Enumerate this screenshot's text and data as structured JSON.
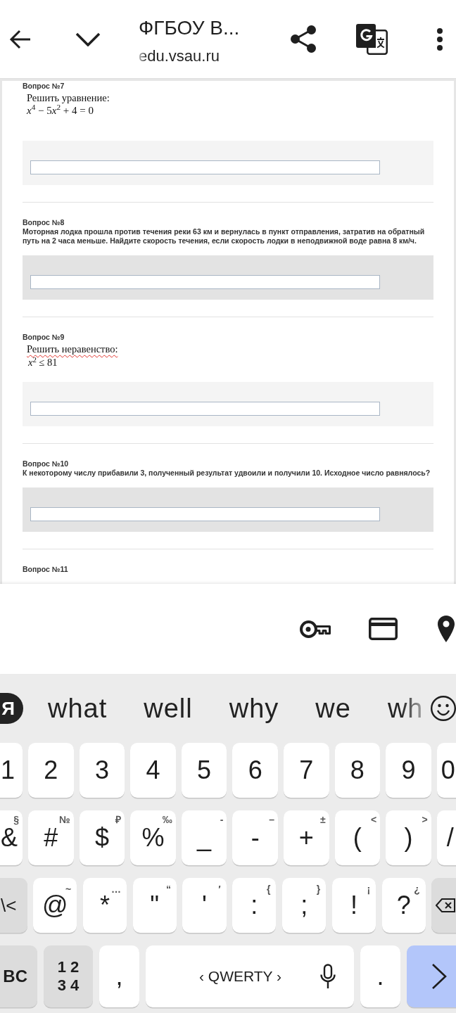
{
  "browser_bar": {
    "title": "ФГБОУ В...",
    "url": "edu.vsau.ru"
  },
  "questions": [
    {
      "heading": "Вопрос №7",
      "kind": "formula",
      "prompt": "Решить уравнение:",
      "spellcheck": false,
      "formula": [
        "*x*$^{4}$ − 5",
        "*x*$^{2}$ + 4 = 0"
      ],
      "display": true
    },
    {
      "heading": "Вопрос №8",
      "kind": "text",
      "text": "Моторная лодка прошла против течения реки 63 км и вернулась в пункт отправления, затратив на обратный путь на 2 часа меньше. Найдите скорость течения, если скорость лодки в неподвижной воде равна 8 км/ч."
    },
    {
      "heading": "Вопрос №9",
      "kind": "formula",
      "prompt": "Решить неравенство:",
      "spellcheck": true,
      "formula": [
        "*x*$^{2}$ ≤ 81"
      ],
      "display": false
    },
    {
      "heading": "Вопрос №10",
      "kind": "text",
      "text": "К некоторому числу прибавили 3, полученный результат удвоили и получили 10. Исходное число равнялось?"
    },
    {
      "heading": "Вопрос №11",
      "kind": "heading_only"
    }
  ],
  "keyboard": {
    "logo": "Я",
    "suggestions": [
      "what",
      "well",
      "why",
      "we",
      "wh"
    ],
    "rows": [
      {
        "keys": [
          {
            "kind": "char",
            "label": "1"
          },
          {
            "kind": "char",
            "label": "2"
          },
          {
            "kind": "char",
            "label": "3"
          },
          {
            "kind": "char",
            "label": "4"
          },
          {
            "kind": "char",
            "label": "5"
          },
          {
            "kind": "char",
            "label": "6"
          },
          {
            "kind": "char",
            "label": "7"
          },
          {
            "kind": "char",
            "label": "8"
          },
          {
            "kind": "char",
            "label": "9"
          },
          {
            "kind": "char",
            "label": "0"
          }
        ]
      },
      {
        "keys": [
          {
            "kind": "char",
            "label": "&",
            "hint": "§"
          },
          {
            "kind": "char",
            "label": "#",
            "hint": "№"
          },
          {
            "kind": "char",
            "label": "$",
            "hint": "₽"
          },
          {
            "kind": "char",
            "label": "%",
            "hint": "‰"
          },
          {
            "kind": "char",
            "label": "_",
            "hint": "-"
          },
          {
            "kind": "char",
            "label": "-",
            "hint": "–"
          },
          {
            "kind": "char",
            "label": "+",
            "hint": "±"
          },
          {
            "kind": "char",
            "label": "(",
            "hint": "<"
          },
          {
            "kind": "char",
            "label": ")",
            "hint": ">"
          },
          {
            "kind": "char",
            "label": "/"
          }
        ]
      },
      {
        "keys": [
          {
            "kind": "function",
            "label": "\\<"
          },
          {
            "kind": "char",
            "label": "@",
            "hint": "~"
          },
          {
            "kind": "char",
            "label": "*",
            "hint": "…"
          },
          {
            "kind": "char",
            "label": "\"",
            "hint": "“"
          },
          {
            "kind": "char",
            "label": "'",
            "hint": "′"
          },
          {
            "kind": "char",
            "label": ":",
            "hint": "{"
          },
          {
            "kind": "char",
            "label": ";",
            "hint": "}"
          },
          {
            "kind": "char",
            "label": "!",
            "hint": "¡"
          },
          {
            "kind": "char",
            "label": "?",
            "hint": "¿"
          },
          {
            "kind": "backspace"
          }
        ]
      },
      {
        "keys": [
          {
            "kind": "function",
            "label": "BC"
          },
          {
            "kind": "function",
            "label": "1 2\n3 4"
          },
          {
            "kind": "char",
            "label": ","
          },
          {
            "kind": "space",
            "label": "‹ QWERTY ›"
          },
          {
            "kind": "char",
            "label": "."
          },
          {
            "kind": "enter"
          }
        ]
      }
    ]
  }
}
